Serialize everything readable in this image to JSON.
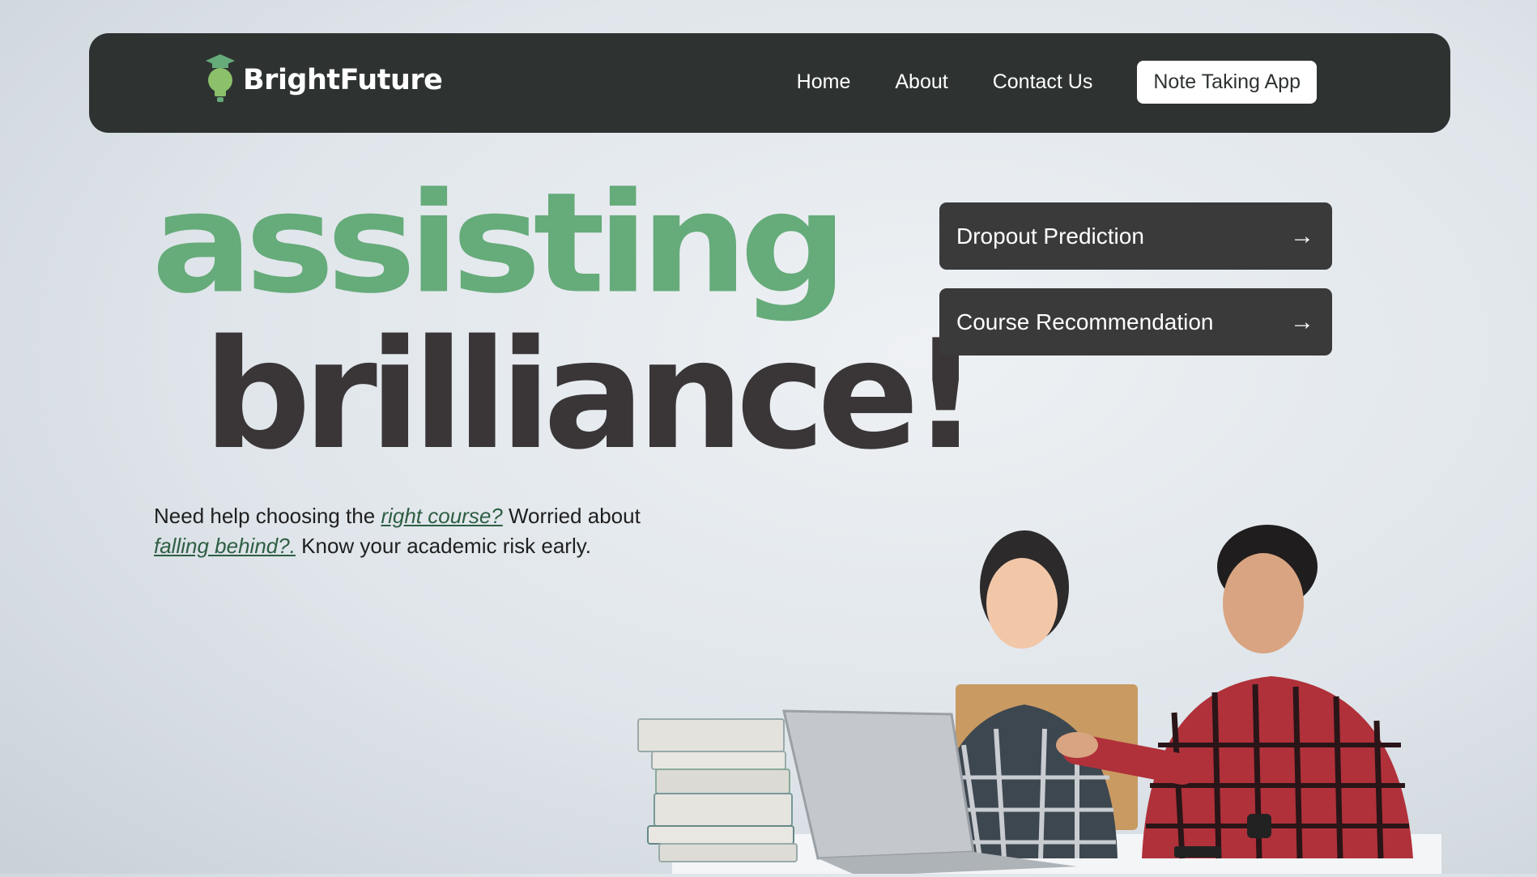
{
  "brand": {
    "name": "BrightFuture",
    "logo_icon": "lightbulb-graduation-cap-icon",
    "accent": "#66ab7a"
  },
  "nav": {
    "links": [
      "Home",
      "About",
      "Contact Us"
    ],
    "button": "Note Taking App"
  },
  "hero": {
    "line1": "assisting",
    "line2": "brilliance!",
    "tagline": {
      "part1": "Need help choosing the ",
      "link1": "right course?",
      "part2": " Worried about ",
      "link2": "falling behind?.",
      "part3": " Know your academic risk early."
    }
  },
  "actions": [
    {
      "label": "Dropout Prediction",
      "icon": "arrow-right-icon"
    },
    {
      "label": "Course Recommendation",
      "icon": "arrow-right-icon"
    }
  ],
  "colors": {
    "nav_bg": "#2e3331",
    "heading_dark": "#3a3637",
    "button_bg": "#3a3a3a"
  }
}
